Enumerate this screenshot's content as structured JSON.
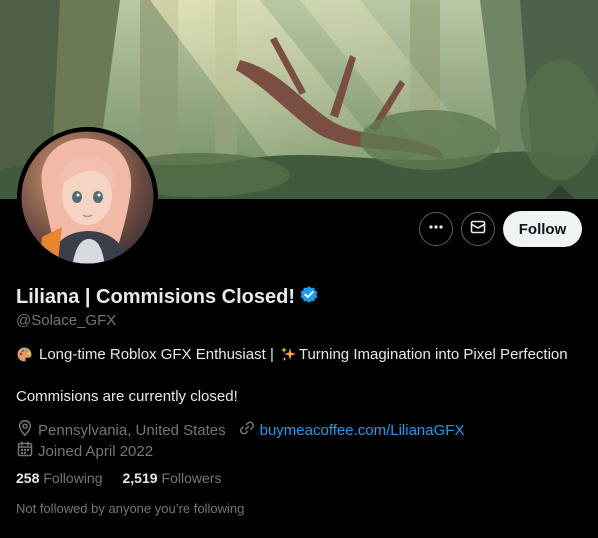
{
  "profile": {
    "display_name": "Liliana | Commisions Closed!",
    "handle": "@Solace_GFX",
    "verified": true,
    "bio_line1_part1": "Long-time Roblox GFX Enthusiast |",
    "bio_line1_part2": "Turning Imagination into Pixel Perfection",
    "bio_line2": "Commisions are currently closed!",
    "location": "Pennsylvania, United States",
    "website": "buymeacoffee.com/LilianaGFX",
    "joined": "Joined April 2022"
  },
  "stats": {
    "following_count": "258",
    "following_label": "Following",
    "followers_count": "2,519",
    "followers_label": "Followers"
  },
  "actions": {
    "follow_label": "Follow",
    "more_icon": "more-icon",
    "message_icon": "mail-icon"
  },
  "note": "Not followed by anyone you’re following",
  "colors": {
    "background": "#000000",
    "text_primary": "#e7e9ea",
    "text_secondary": "#71767b",
    "link": "#1d9bf0",
    "verified": "#1d9bf0",
    "follow_button_bg": "#eff3f4"
  }
}
